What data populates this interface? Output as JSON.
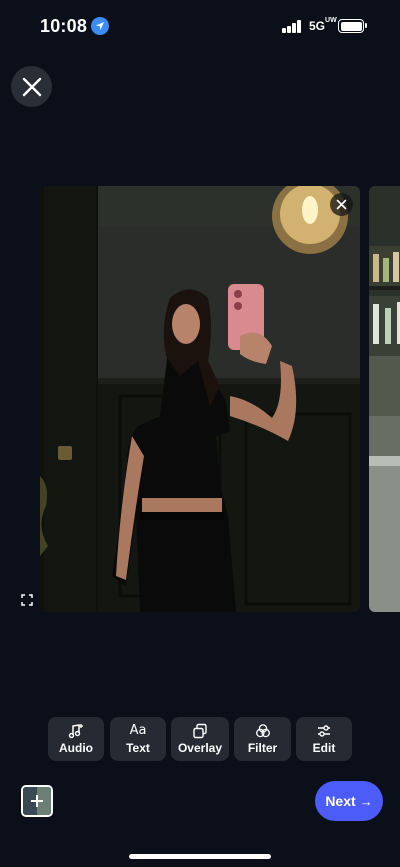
{
  "status_bar": {
    "time": "10:08",
    "network": "5G",
    "network_superscript": "UW",
    "icons": [
      "location-arrow-icon",
      "signal-icon",
      "battery-icon"
    ]
  },
  "top_bar": {
    "close_icon": "close-icon"
  },
  "media": {
    "current_index": 1,
    "remove_icon": "close-icon",
    "expand_icon": "expand-icon"
  },
  "toolbar": {
    "items": [
      {
        "label": "Audio",
        "icon": "music-note-plus-icon"
      },
      {
        "label": "Text",
        "icon": "text-icon",
        "glyph": "Aa"
      },
      {
        "label": "Overlay",
        "icon": "overlay-icon"
      },
      {
        "label": "Filter",
        "icon": "filter-icon"
      },
      {
        "label": "Edit",
        "icon": "sliders-icon"
      }
    ]
  },
  "bottom_bar": {
    "add_media_icon": "plus-icon",
    "next_label": "Next",
    "next_arrow": "→"
  },
  "colors": {
    "background": "#0b0f19",
    "tool_button": "#262a32",
    "accent": "#4b5cf8",
    "location": "#3b8cf5"
  }
}
